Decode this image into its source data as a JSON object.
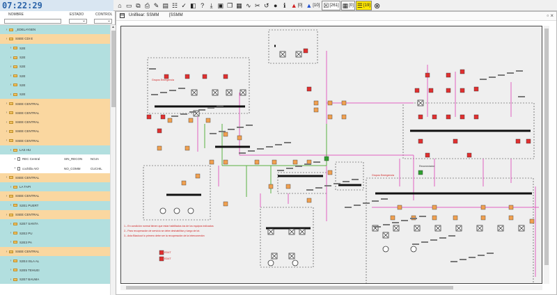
{
  "clock": "07:22:29",
  "toolbar": {
    "alarm_counts": [
      "[0]",
      "[10]",
      "[261]",
      "[0]",
      "[19]"
    ]
  },
  "left_panel": {
    "columns": {
      "name": "NOMBRE",
      "state": "ESTADO",
      "control": "CONTROL"
    },
    "rows": [
      {
        "label": "_EDELAYSEN",
        "color": "teal",
        "indent": 1,
        "kind": "fold"
      },
      {
        "label": "SSEE CDI E",
        "color": "orange",
        "indent": 1,
        "kind": "fold"
      },
      {
        "label": "S2E",
        "color": "teal",
        "indent": 2,
        "kind": "fold"
      },
      {
        "label": "S2E",
        "color": "teal",
        "indent": 2,
        "kind": "fold"
      },
      {
        "label": "S2E",
        "color": "teal",
        "indent": 2,
        "kind": "fold"
      },
      {
        "label": "S2E",
        "color": "teal",
        "indent": 2,
        "kind": "fold"
      },
      {
        "label": "S2E",
        "color": "teal",
        "indent": 2,
        "kind": "fold"
      },
      {
        "label": "S2E",
        "color": "teal",
        "indent": 2,
        "kind": "fold"
      },
      {
        "label": "SSEE CENTRAL",
        "color": "orange",
        "indent": 1,
        "kind": "fold"
      },
      {
        "label": "SSEE CENTRAL",
        "color": "orange",
        "indent": 1,
        "kind": "fold"
      },
      {
        "label": "SSEE CENTRAL",
        "color": "orange",
        "indent": 1,
        "kind": "fold"
      },
      {
        "label": "SSEE CENTRAL",
        "color": "orange",
        "indent": 1,
        "kind": "fold"
      },
      {
        "label": "SSEE CENTRAL",
        "color": "orange",
        "indent": 1,
        "kind": "fold"
      },
      {
        "label": "LAS HU",
        "color": "teal",
        "indent": 2,
        "kind": "fold"
      },
      {
        "label": "REC Central",
        "state": "SIN_RECON",
        "control": "NOJA",
        "color": "white",
        "indent": 3,
        "kind": "doc"
      },
      {
        "label": "cochilla AIO",
        "state": "NO_COMM",
        "control": "CUCHIL",
        "color": "white",
        "indent": 3,
        "kind": "doc"
      },
      {
        "label": "SSEE CENTRAL",
        "color": "orange",
        "indent": 1,
        "kind": "fold"
      },
      {
        "label": "LA TAPI",
        "color": "teal",
        "indent": 2,
        "kind": "fold"
      },
      {
        "label": "SSEE CENTRAL",
        "color": "orange",
        "indent": 1,
        "kind": "fold"
      },
      {
        "label": "S2E1 PUERT",
        "color": "teal",
        "indent": 2,
        "kind": "fold"
      },
      {
        "label": "SSEE CENTRAL",
        "color": "orange",
        "indent": 1,
        "kind": "fold"
      },
      {
        "label": "S2E7 SANTA",
        "color": "teal",
        "indent": 2,
        "kind": "fold"
      },
      {
        "label": "S2E2 PU",
        "color": "teal",
        "indent": 2,
        "kind": "fold"
      },
      {
        "label": "S2E3 PA",
        "color": "teal",
        "indent": 2,
        "kind": "fold"
      },
      {
        "label": "SSEE CENTRAL",
        "color": "orange",
        "indent": 1,
        "kind": "fold"
      },
      {
        "label": "S2E4 ISLA AL",
        "color": "teal",
        "indent": 2,
        "kind": "fold"
      },
      {
        "label": "S2E5 TEHUEI",
        "color": "teal",
        "indent": 2,
        "kind": "fold"
      },
      {
        "label": "S2E7 BAUMA",
        "color": "teal",
        "indent": 2,
        "kind": "fold"
      }
    ]
  },
  "main": {
    "title": "Unifilear: SSMM",
    "title_tag": "[SSMM",
    "window_buttons": "▫ ×",
    "diagram": {
      "notes": [
        "1.- En condición normal tienen que estar habilitados ios            de los equipos indicados",
        "2.- Para recuperación de servicio se debe deshabilitar              y luego de lot.",
        "3.- Anla Blackout lo primero debe ser la recuperación de la interconexión"
      ],
      "small_labels": [
        "Grupos Emergencia",
        "Grupos Emergencia",
        "Reconectador"
      ],
      "red_tags": [
        "ED4T",
        "ED4T"
      ]
    }
  },
  "colors": {
    "accent": "#2a63a8",
    "orange_row": "#fad7a0",
    "teal_row": "#b2dfdf",
    "breaker_red": "#e03030",
    "breaker_orange": "#f0a050",
    "breaker_green": "#30a030",
    "line_pink": "#e060c0",
    "line_green": "#5ab040"
  },
  "icons": [
    "home-icon",
    "monitor-icon",
    "screens-icon",
    "print-icon",
    "pen-icon",
    "doc-icon",
    "checklist-icon",
    "check-icon",
    "layers-icon",
    "help-icon",
    "download-icon",
    "save-icon",
    "copy-icon",
    "clipboard-icon",
    "chart-icon",
    "tools-icon",
    "undo-icon",
    "user-icon",
    "info-icon",
    "alarm-red-icon",
    "alarm-blue-icon",
    "alarm-box-icon",
    "alarm-black-icon",
    "alarm-yellow-icon",
    "close-circle-icon"
  ]
}
